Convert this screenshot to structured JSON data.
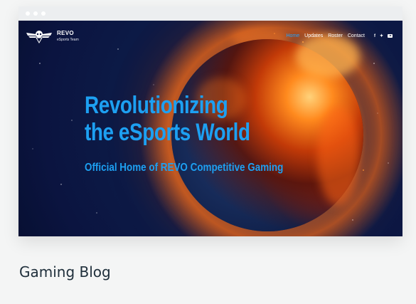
{
  "browser": {
    "dots": [
      "",
      "",
      ""
    ]
  },
  "site": {
    "logo": {
      "name": "REVO",
      "subtitle": "eSports Team"
    },
    "nav": [
      {
        "label": "Home",
        "active": true
      },
      {
        "label": "Updates",
        "active": false
      },
      {
        "label": "Roster",
        "active": false
      },
      {
        "label": "Contact",
        "active": false
      }
    ],
    "social": {
      "facebook": "f",
      "twitter": "✦",
      "youtube": ""
    },
    "hero": {
      "headline_line1": "Revolutionizing",
      "headline_line2": "the eSports World",
      "tagline": "Official Home of REVO Competitive Gaming"
    }
  },
  "template": {
    "title": "Gaming Blog"
  },
  "colors": {
    "accent": "#1da0f2",
    "page_bg": "#f4f5f5",
    "hero_bg": "#0b1440",
    "caption": "#20303c"
  }
}
